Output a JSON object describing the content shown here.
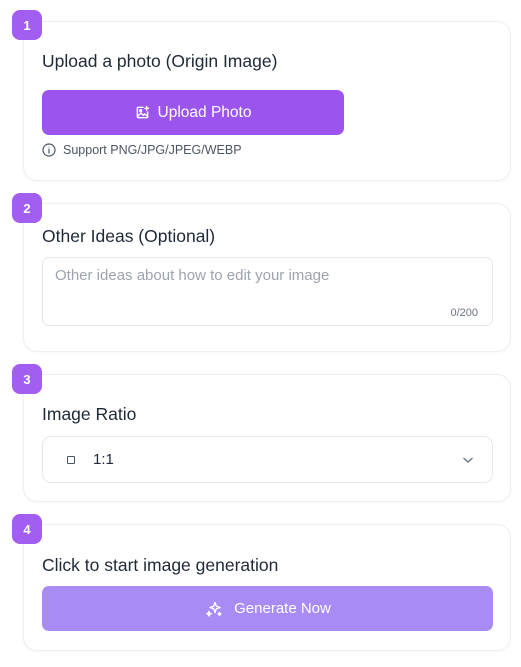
{
  "steps": [
    {
      "number": "1",
      "title": "Upload a photo (Origin Image)"
    },
    {
      "number": "2",
      "title": "Other Ideas (Optional)"
    },
    {
      "number": "3",
      "title": "Image Ratio"
    },
    {
      "number": "4",
      "title": "Click to start image generation"
    }
  ],
  "upload": {
    "button_label": "Upload Photo",
    "button_icon": "image-plus-icon",
    "support_icon": "info-icon",
    "support_text": "Support PNG/JPG/JPEG/WEBP"
  },
  "ideas": {
    "placeholder": "Other ideas about how to edit your image",
    "value": "",
    "counter": "0/200"
  },
  "ratio": {
    "selected": "1:1",
    "icon": "square-icon",
    "dropdown_icon": "chevron-down-icon"
  },
  "generate": {
    "button_label": "Generate Now",
    "button_icon": "sparkles-icon"
  },
  "colors": {
    "accent": "#a15ef1",
    "upload_button": "#9b54ee",
    "generate_button": "#a98bf6",
    "border": "#eeeef2"
  }
}
